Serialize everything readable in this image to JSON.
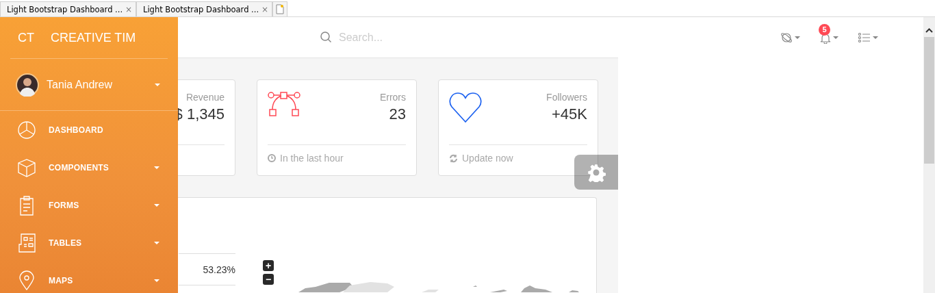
{
  "browser_tabs": [
    {
      "title": "Light Bootstrap Dashboard ...",
      "close": "×"
    },
    {
      "title": "Light Bootstrap Dashboard ...",
      "close": "×"
    }
  ],
  "sidebar": {
    "logo_mini": "CT",
    "logo": "CREATIVE TIM",
    "user": {
      "name": "Tania Andrew"
    },
    "items": [
      {
        "kind": "pie",
        "label": "DASHBOARD",
        "has_caret": false
      },
      {
        "kind": "cube",
        "label": "COMPONENTS",
        "has_caret": true
      },
      {
        "kind": "clipboard",
        "label": "FORMS",
        "has_caret": true
      },
      {
        "kind": "table",
        "label": "TABLES",
        "has_caret": true
      },
      {
        "kind": "pin",
        "label": "MAPS",
        "has_caret": true
      }
    ]
  },
  "navbar": {
    "search": {
      "placeholder": "Search..."
    },
    "notifications": {
      "count": "5"
    }
  },
  "stats": [
    {
      "kind": "revenue",
      "label": "Revenue",
      "value": "$ 1,345"
    },
    {
      "kind": "errors",
      "label": "Errors",
      "value": "23",
      "footer": {
        "kind": "clock",
        "text": "In the last hour"
      }
    },
    {
      "kind": "followers",
      "label": "Followers",
      "value": "+45K",
      "footer": {
        "kind": "refresh",
        "text": "Update now"
      }
    }
  ],
  "map_card": {
    "rows": [
      {
        "value": "53.23%"
      }
    ],
    "zoom_in": "+",
    "zoom_out": "−"
  }
}
